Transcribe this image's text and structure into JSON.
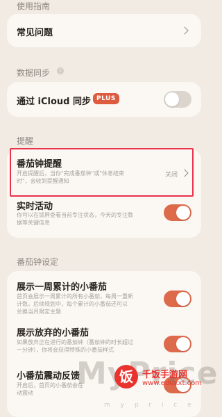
{
  "usage_guide": {
    "title": "使用指南",
    "faq_label": "常见问题"
  },
  "data_sync": {
    "title": "数据同步",
    "info_icon": "i",
    "icloud_label": "通过 iCloud 同步",
    "plus_badge": "PLUS",
    "icloud_enabled": false
  },
  "reminders": {
    "title": "提醒",
    "pomodoro_reminder": {
      "title": "番茄钟提醒",
      "desc_line1": "开启提醒后，当你\"完成番茄钟\"或\"休息结束",
      "desc_line2": "时\"，会收到提醒通知",
      "value": "关闭"
    },
    "live_activity": {
      "title": "实时活动",
      "desc_line1": "你可以在锁屏查看当前专注状态，今天的专注数",
      "desc_line2": "据等关键信息",
      "enabled": true
    }
  },
  "pomodoro_settings": {
    "title": "番茄钟设定",
    "week_total": {
      "title": "展示一周累计的小番茄",
      "desc_line1": "首页会展示一周累计的所有小番茄，每周一重新",
      "desc_line2": "计数。后续规划中，每个累计的小番茄还可以",
      "desc_line3": "兑换当月限定主题",
      "enabled": true
    },
    "abandoned": {
      "title": "展示放弃的小番茄",
      "desc_line1": "如果放弃正在进行的番茄钟（番茄钟的时长超过",
      "desc_line2": "一分钟），你将会获得特殊的小番茄样式",
      "enabled": true
    },
    "vibration": {
      "title": "小番茄震动反馈",
      "desc_line1": "开启后，首页的小番茄会在",
      "desc_line2": "动震动",
      "enabled": true
    }
  },
  "watermark": {
    "text": "MyPrice",
    "sub": "m y p r i c e",
    "logo_char": "饭",
    "site_name": "千饭手游网",
    "site_url": "www.eduxxt.com"
  },
  "colors": {
    "background": "#f2ebe3",
    "card": "#fbf8f4",
    "accent": "#dd6a4b",
    "highlight": "#e8334a"
  }
}
